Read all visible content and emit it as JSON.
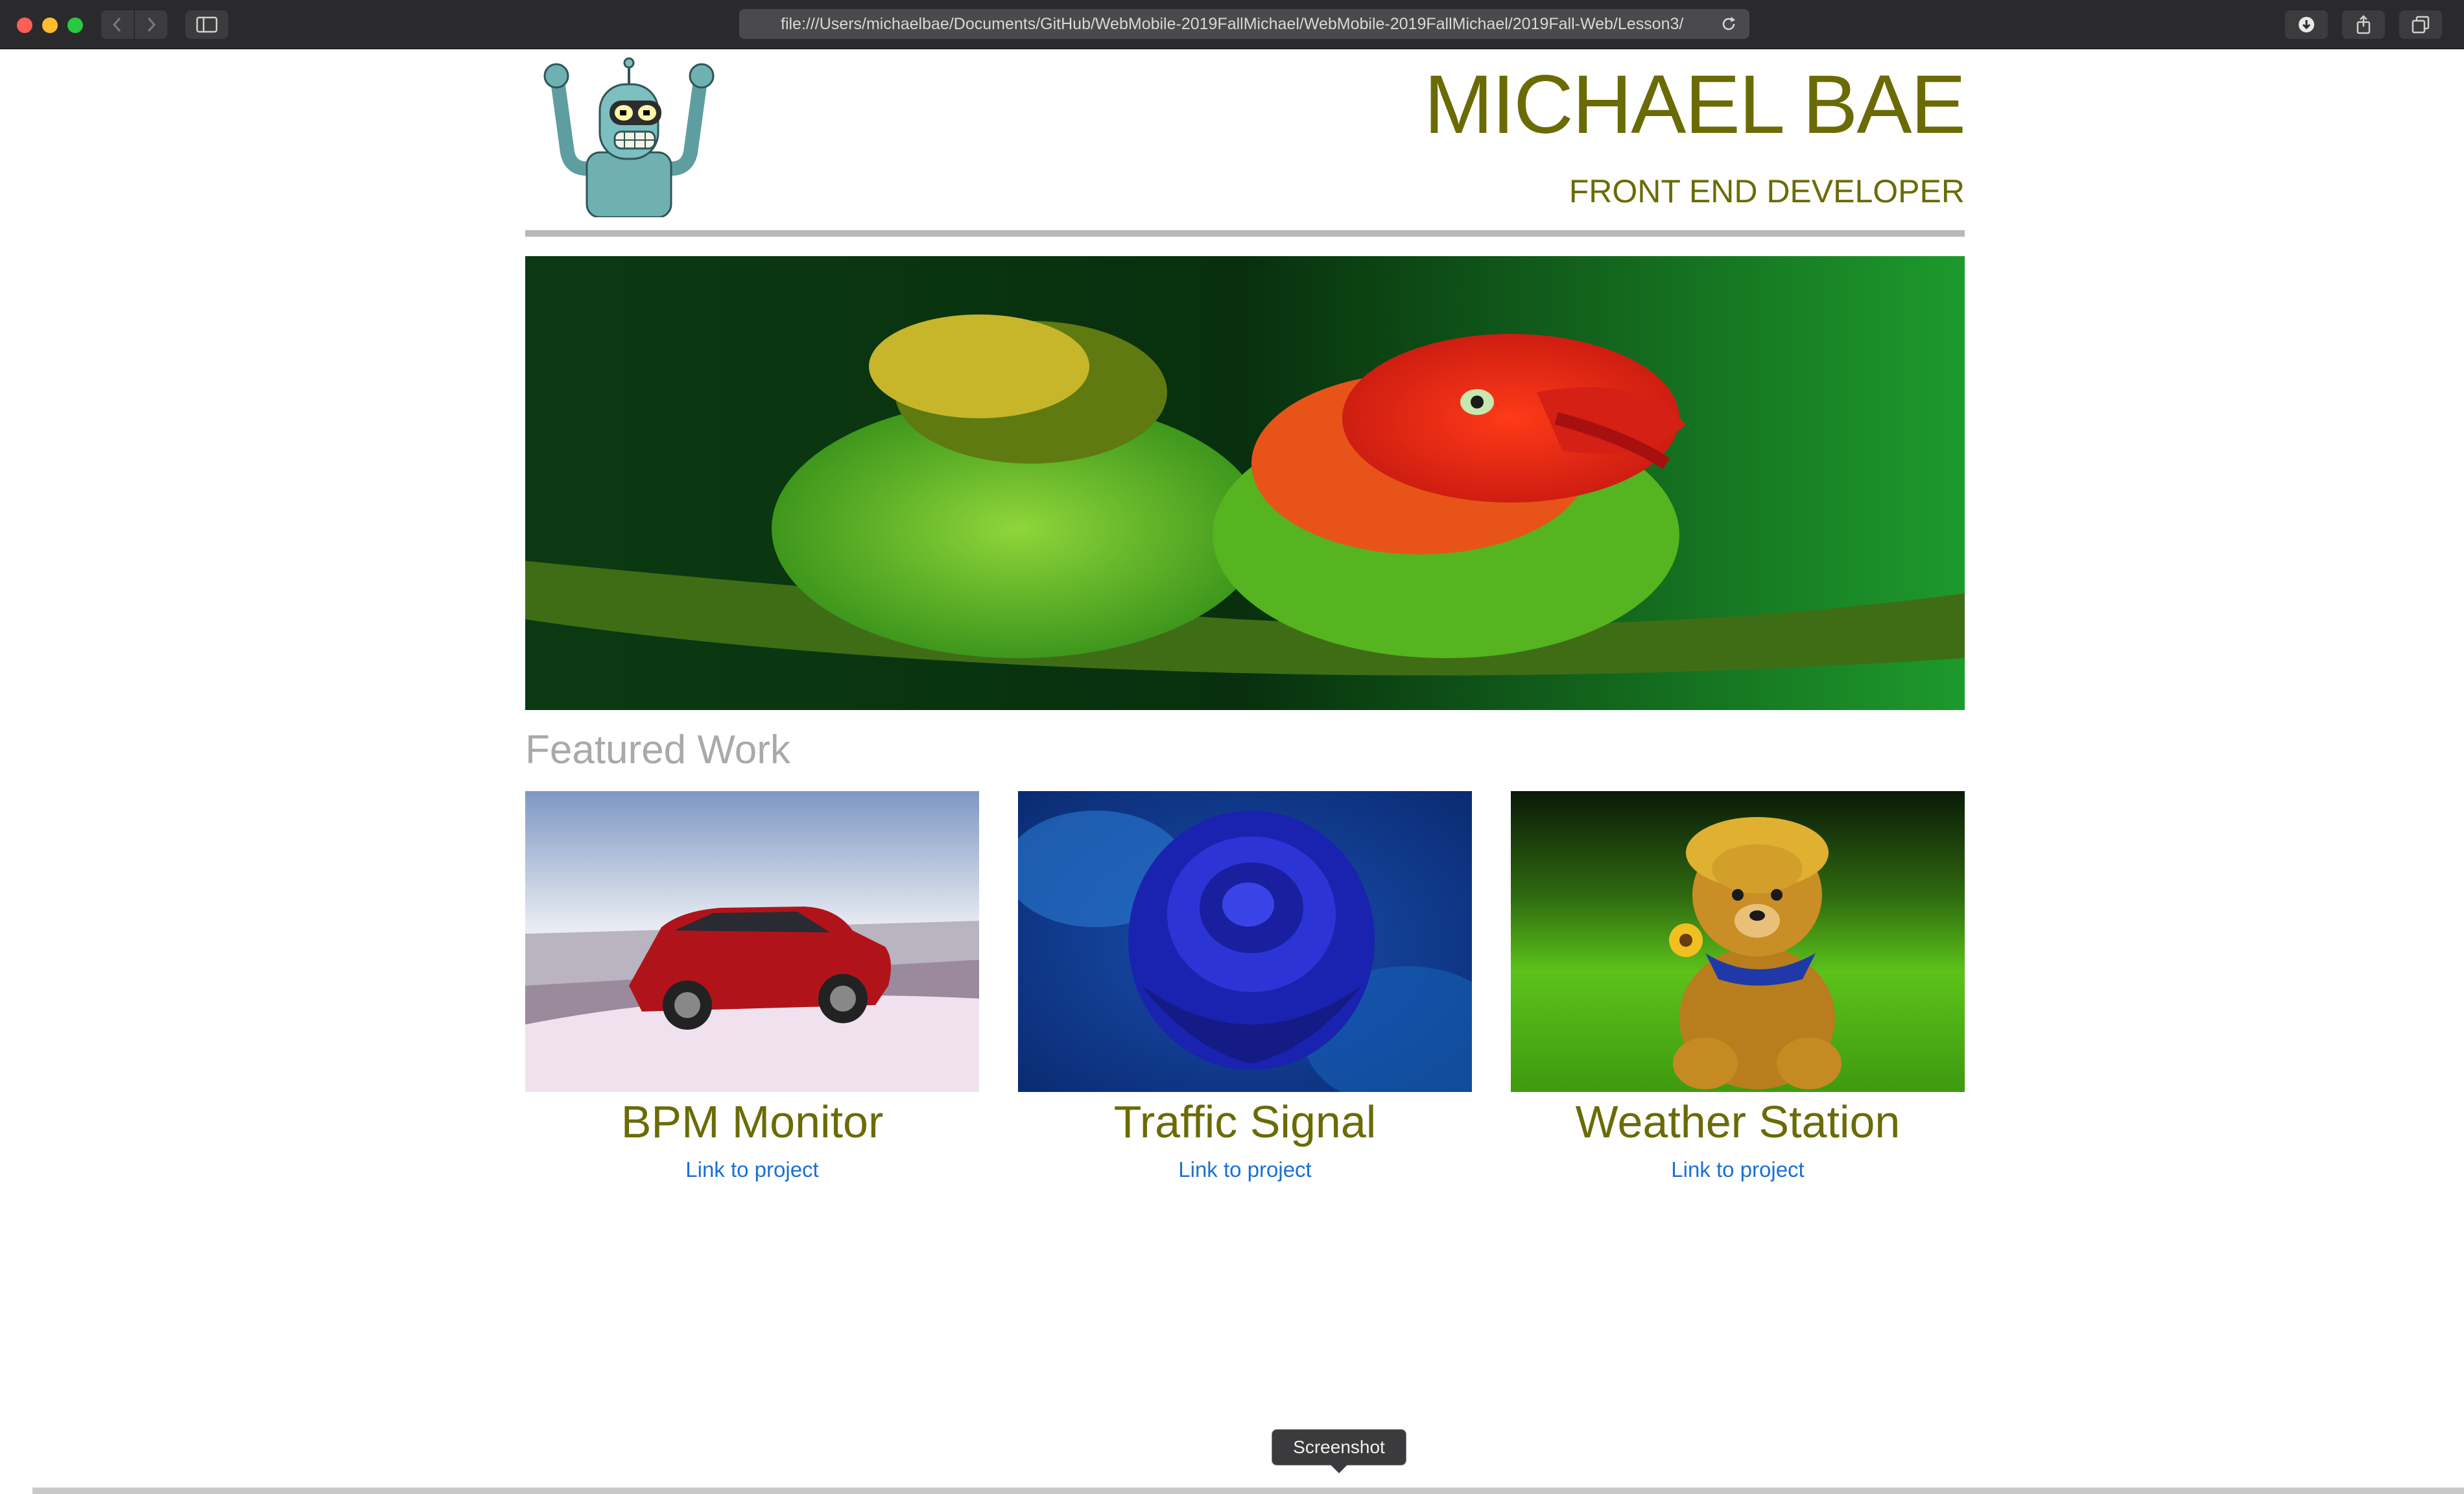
{
  "browser": {
    "url": "file:///Users/michaelbae/Documents/GitHub/WebMobile-2019FallMichael/WebMobile-2019FallMichael/2019Fall-Web/Lesson3/"
  },
  "header": {
    "name": "MICHAEL BAE",
    "role": "FRONT END DEVELOPER",
    "color": "#6b6b05"
  },
  "featured": {
    "title": "Featured Work",
    "projects": [
      {
        "title": "BPM Monitor",
        "link_label": "Link to project"
      },
      {
        "title": "Traffic Signal",
        "link_label": "Link to project"
      },
      {
        "title": "Weather Station",
        "link_label": "Link to project"
      }
    ]
  },
  "tooltip": {
    "label": "Screenshot"
  },
  "icons": [
    "back-icon",
    "forward-icon",
    "sidebar-icon",
    "reload-icon",
    "download-icon",
    "share-icon",
    "tabs-icon"
  ],
  "link_color": "#1a6fd6"
}
